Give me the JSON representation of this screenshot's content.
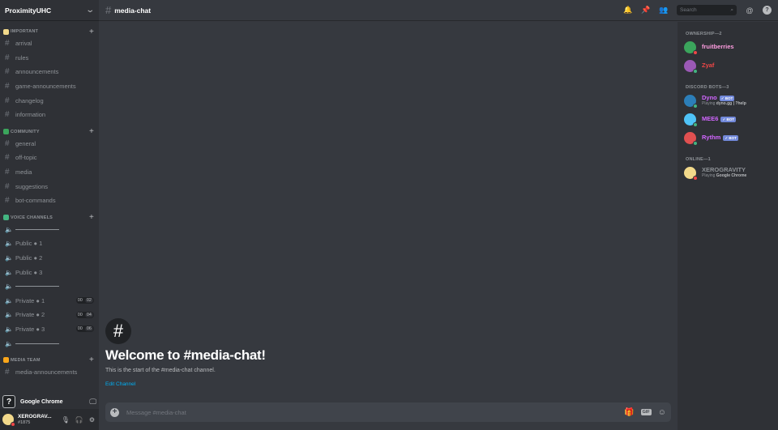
{
  "server": {
    "name": "ProximityUHC"
  },
  "categories": [
    {
      "label": "IMPORTANT",
      "emoji_color": "#f2d98b",
      "channels": [
        "arrival",
        "rules",
        "announcements",
        "game-announcements",
        "changelog",
        "information"
      ]
    },
    {
      "label": "COMMUNITY",
      "emoji_color": "#3ba55c",
      "channels": [
        "general",
        "off-topic",
        "media",
        "suggestions",
        "bot-commands"
      ]
    },
    {
      "label": "VOICE CHANNELS",
      "emoji_color": "#43b581",
      "voice": [
        {
          "label": "",
          "divider": true
        },
        {
          "label": "Public ● 1"
        },
        {
          "label": "Public ● 2"
        },
        {
          "label": "Public ● 3"
        },
        {
          "label": "",
          "divider": true
        },
        {
          "label": "Private ● 1",
          "count": "00",
          "limit": "02"
        },
        {
          "label": "Private ● 2",
          "count": "00",
          "limit": "04"
        },
        {
          "label": "Private ● 3",
          "count": "00",
          "limit": "06"
        },
        {
          "label": "",
          "divider": true
        }
      ]
    },
    {
      "label": "MEDIA TEAM",
      "emoji_color": "#faa61a",
      "channels": [
        "media-announcements"
      ]
    }
  ],
  "activity": {
    "icon": "?",
    "name": "Google Chrome"
  },
  "user": {
    "name": "XEROGRAV...",
    "tag": "#1875",
    "status_color": "#f04747"
  },
  "header": {
    "channel": "media-chat",
    "search_placeholder": "Search"
  },
  "welcome": {
    "title": "Welcome to #media-chat!",
    "subtitle": "This is the start of the #media-chat channel.",
    "edit_label": "Edit Channel"
  },
  "composer": {
    "placeholder": "Message #media-chat"
  },
  "member_groups": [
    {
      "label": "OWNERSHIP—2",
      "members": [
        {
          "name": "fruitberries",
          "color": "#ff9de0",
          "avatar": "#3ba55c",
          "status": "#f04747",
          "activity": "",
          "activity_bold": ""
        },
        {
          "name": "Zyaf",
          "color": "#f04747",
          "avatar": "#9b59b6",
          "status": "#43b581",
          "activity": "",
          "activity_bold": ""
        }
      ]
    },
    {
      "label": "DISCORD BOTS—3",
      "members": [
        {
          "name": "Dyno",
          "color": "#d166ff",
          "avatar": "#2c7eb8",
          "status": "#43b581",
          "bot": "✓ BOT",
          "activity": "Playing ",
          "activity_bold": "dyno.gg | ?help"
        },
        {
          "name": "MEE6",
          "color": "#d166ff",
          "avatar": "#4fc3f7",
          "status": "#43b581",
          "bot": "✓ BOT",
          "activity": "",
          "activity_bold": ""
        },
        {
          "name": "Rythm",
          "color": "#d166ff",
          "avatar": "#e05050",
          "status": "#43b581",
          "bot": "✓ BOT",
          "activity": "",
          "activity_bold": ""
        }
      ]
    },
    {
      "label": "ONLINE—1",
      "members": [
        {
          "name": "XEROGRAVITY",
          "color": "#8e9297",
          "avatar": "#f2d98b",
          "status": "#f04747",
          "activity": "Playing ",
          "activity_bold": "Google Chrome"
        }
      ]
    }
  ],
  "colors": {
    "accent": "#7289da",
    "link": "#00b0f4",
    "background": "#36393f",
    "sidebar": "#2f3136"
  }
}
